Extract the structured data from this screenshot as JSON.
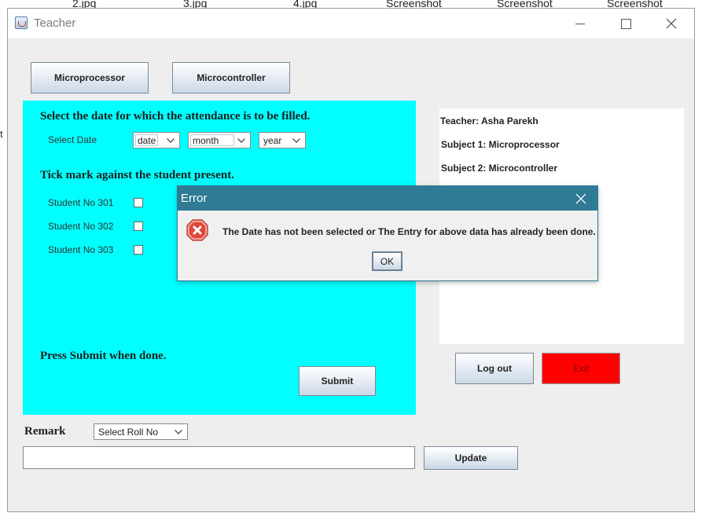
{
  "desktop": {
    "files": [
      "2.jpg",
      "3.jpg",
      "4.jpg",
      "Screenshot",
      "Screenshot",
      "Screenshot"
    ],
    "edge_char": "t"
  },
  "window": {
    "title": "Teacher",
    "icon": "java-cup-icon"
  },
  "toolbar": {
    "microprocessor_label": "Microprocessor",
    "microcontroller_label": "Microcontroller"
  },
  "attendance": {
    "date_prompt": "Select the date for which the attendance is to be filled.",
    "select_date_label": "Select Date",
    "date_value": "date",
    "month_value": "month",
    "year_value": "year",
    "tick_prompt": "Tick mark against the student present.",
    "students": [
      {
        "label": "Student No 301",
        "checked": false
      },
      {
        "label": "Student No 302",
        "checked": false
      },
      {
        "label": "Student No 303",
        "checked": false
      }
    ],
    "submit_prompt": "Press Submit when done.",
    "submit_label": "Submit",
    "panel_color": "#00ffff"
  },
  "info": {
    "teacher": "Teacher: Asha Parekh",
    "subject1": "Subject 1: Microprocessor",
    "subject2": "Subject 2: Microcontroller"
  },
  "actions": {
    "logout_label": "Log out",
    "exit_label": "Exit",
    "exit_color": "#ff0000"
  },
  "remark": {
    "label": "Remark",
    "roll_value": "Select Roll No",
    "text_value": "",
    "update_label": "Update"
  },
  "dialog": {
    "title": "Error",
    "message": "The Date has not been selected or The Entry for above data has already been done.",
    "ok_label": "OK",
    "icon": "error-x-icon",
    "title_color": "#2f7a95"
  }
}
